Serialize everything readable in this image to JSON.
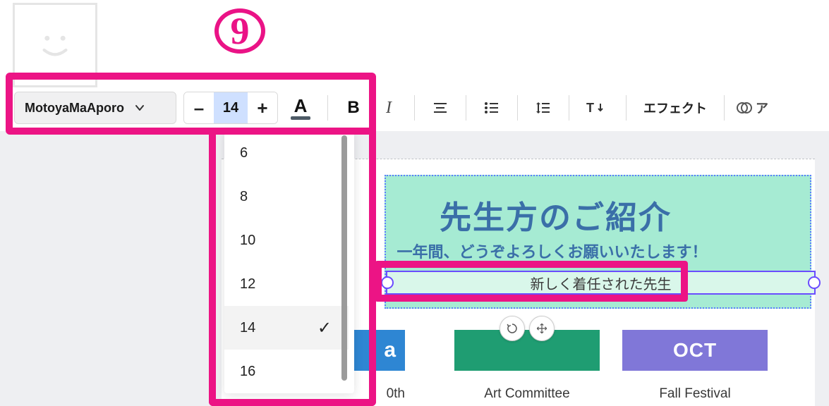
{
  "annotation": {
    "number": "9"
  },
  "toolbar": {
    "font_name": "MotoyaMaAporo",
    "font_size_value": "14",
    "minus": "–",
    "plus": "+",
    "color_letter": "A",
    "bold": "B",
    "italic": "I",
    "effects_label": "エフェクト",
    "extra_label_partial": "ア"
  },
  "size_dropdown": {
    "options": [
      "6",
      "8",
      "10",
      "12",
      "14",
      "16"
    ],
    "selected": "14"
  },
  "canvas": {
    "hero_title": "先生方のご紹介",
    "hero_subtitle": "一年間、どうぞよろしくお願いいたします！",
    "selected_textbox": "新しく着任された先生"
  },
  "tiles": [
    {
      "month_partial": "a",
      "caption_partial": "0th",
      "color": "blue"
    },
    {
      "month_partial": "",
      "caption": "Art Committee",
      "color": "green"
    },
    {
      "month": "OCT",
      "caption": "Fall Festival",
      "color": "purple"
    }
  ]
}
